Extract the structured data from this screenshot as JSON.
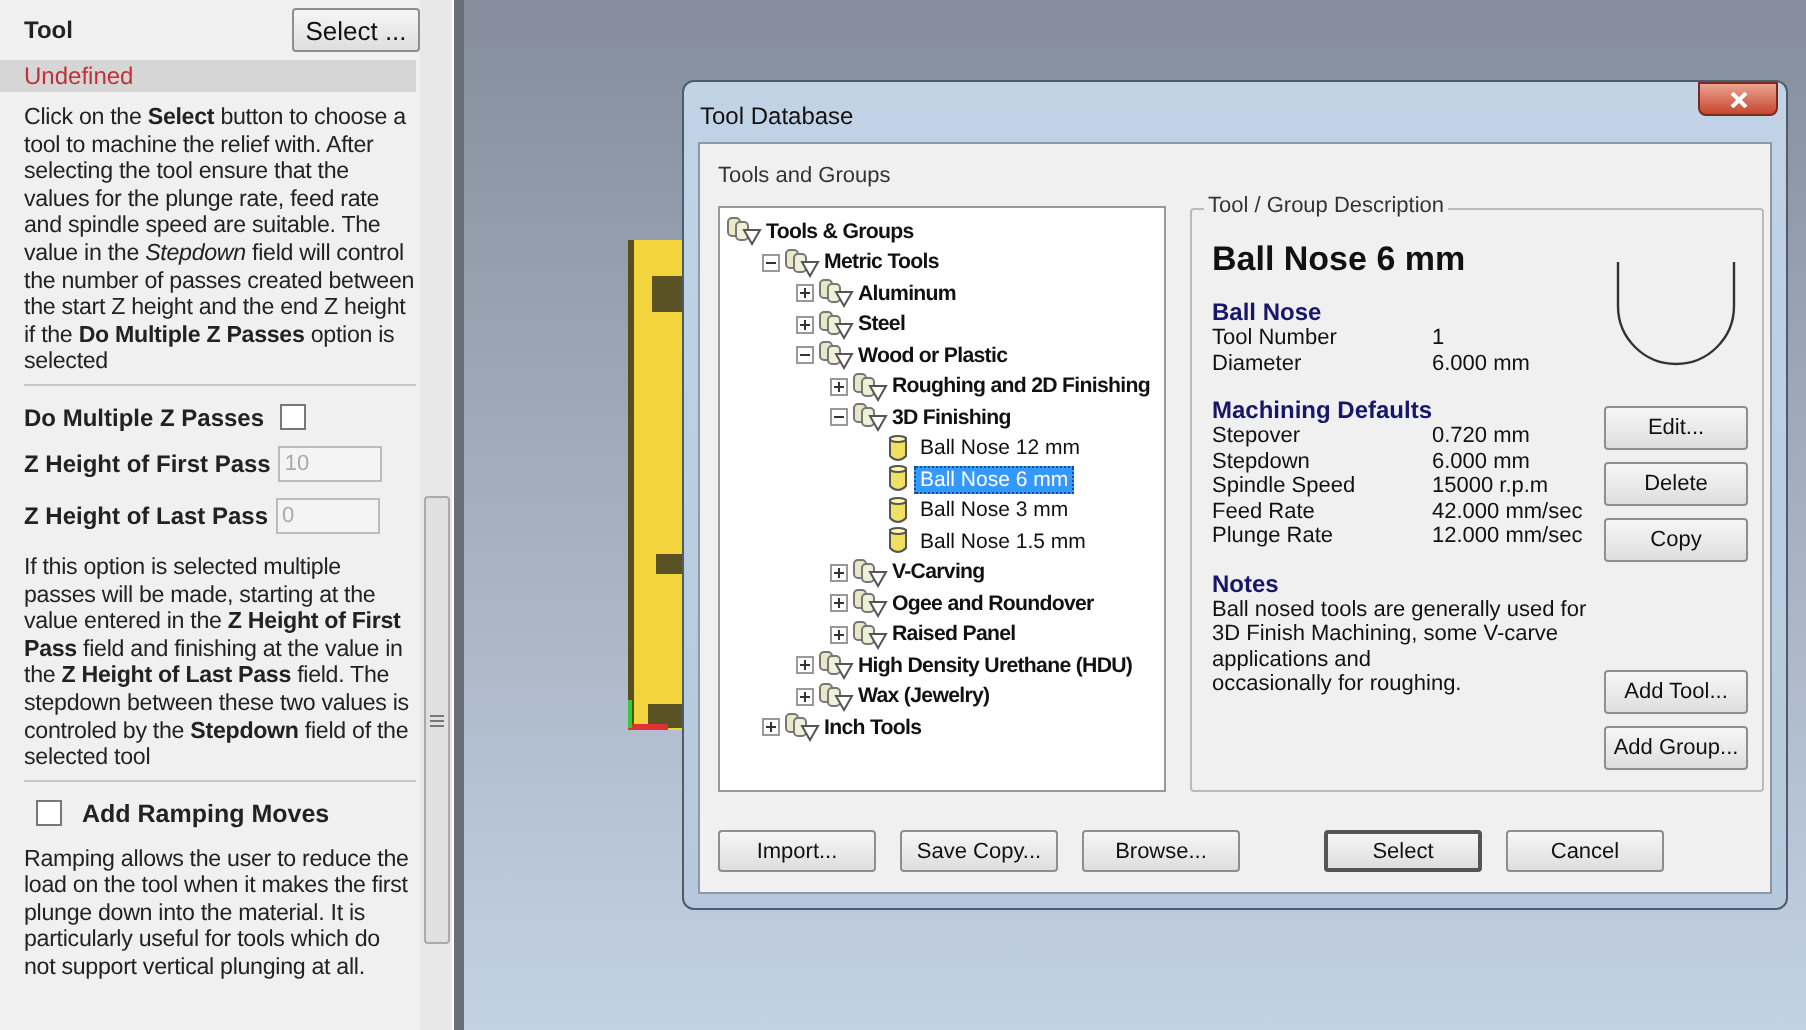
{
  "left_panel": {
    "tool_label": "Tool",
    "select_button": "Select ...",
    "tool_status": "Undefined",
    "intro": "Click on the **Select** button to choose a tool to machine the relief with. After selecting the tool ensure that the values for the plunge rate, feed rate and spindle speed are suitable. The value in the *Stepdown* field will control the number of passes created between the start Z height and the end Z height if the **Do Multiple Z Passes** option is selected",
    "multiple_passes": {
      "label": "Do Multiple Z Passes",
      "checked": false
    },
    "fields": [
      {
        "label": "Z Height of First Pass",
        "value": "10",
        "disabled": true
      },
      {
        "label": "Z Height of Last Pass",
        "value": "0",
        "disabled": true
      }
    ],
    "passes_help": "If this option is selected multiple passes will be made, starting at the value entered in the **Z Height of First Pass** field and finishing at the value in the **Z Height of Last Pass** field. The stepdown between these two values is controled by the **Stepdown** field of the selected tool",
    "ramping": {
      "label": "Add Ramping Moves",
      "checked": false
    },
    "ramping_help": "Ramping allows the user to reduce the load on the tool when it makes the first plunge down into the material. It is particularly useful for tools which do not support vertical plunging at all."
  },
  "dialog": {
    "title": "Tool Database",
    "tree_label": "Tools and Groups",
    "tree": [
      {
        "label": "Tools & Groups",
        "kind": "root",
        "children": [
          {
            "label": "Metric Tools",
            "kind": "group",
            "expanded": true,
            "children": [
              {
                "label": "Aluminum",
                "kind": "group",
                "expanded": false
              },
              {
                "label": "Steel",
                "kind": "group",
                "expanded": false
              },
              {
                "label": "Wood or Plastic",
                "kind": "group",
                "expanded": true,
                "children": [
                  {
                    "label": "Roughing and 2D Finishing",
                    "kind": "group",
                    "expanded": false
                  },
                  {
                    "label": "3D Finishing",
                    "kind": "group",
                    "expanded": true,
                    "children": [
                      {
                        "label": "Ball Nose 12 mm",
                        "kind": "tool",
                        "selected": false
                      },
                      {
                        "label": "Ball Nose 6 mm",
                        "kind": "tool",
                        "selected": true
                      },
                      {
                        "label": "Ball Nose 3 mm",
                        "kind": "tool",
                        "selected": false
                      },
                      {
                        "label": "Ball Nose 1.5 mm",
                        "kind": "tool",
                        "selected": false
                      }
                    ]
                  },
                  {
                    "label": "V-Carving",
                    "kind": "group",
                    "expanded": false
                  },
                  {
                    "label": "Ogee and Roundover",
                    "kind": "group",
                    "expanded": false
                  },
                  {
                    "label": "Raised Panel",
                    "kind": "group",
                    "expanded": false
                  }
                ]
              },
              {
                "label": "High Density Urethane (HDU)",
                "kind": "group",
                "expanded": false
              },
              {
                "label": "Wax (Jewelry)",
                "kind": "group",
                "expanded": false
              }
            ]
          },
          {
            "label": "Inch Tools",
            "kind": "group",
            "expanded": false
          }
        ]
      }
    ],
    "description": {
      "legend": "Tool / Group Description",
      "title": "Ball Nose 6 mm",
      "sections": [
        {
          "heading": "Ball Nose",
          "rows": [
            {
              "label": "Tool Number",
              "value": "1"
            },
            {
              "label": "Diameter",
              "value": "6.000 mm"
            }
          ]
        },
        {
          "heading": "Machining Defaults",
          "rows": [
            {
              "label": "Stepover",
              "value": "0.720 mm"
            },
            {
              "label": "Stepdown",
              "value": "6.000 mm"
            },
            {
              "label": "Spindle Speed",
              "value": "15000 r.p.m"
            },
            {
              "label": "Feed Rate",
              "value": "42.000 mm/sec"
            },
            {
              "label": "Plunge Rate",
              "value": "12.000 mm/sec"
            }
          ]
        }
      ],
      "notes_heading": "Notes",
      "notes": [
        "Ball nosed tools are generally used for 3D Finish Machining, some V-carve applications and",
        "occasionally for roughing."
      ],
      "tool_buttons": [
        "Edit...",
        "Delete",
        "Copy"
      ],
      "group_buttons": [
        "Add Tool...",
        "Add Group..."
      ]
    },
    "bottom_buttons": [
      {
        "label": "Import...",
        "default": false
      },
      {
        "label": "Save Copy...",
        "default": false
      },
      {
        "label": "Browse...",
        "default": false
      },
      {
        "label": "Select",
        "default": true
      },
      {
        "label": "Cancel",
        "default": false
      }
    ]
  }
}
